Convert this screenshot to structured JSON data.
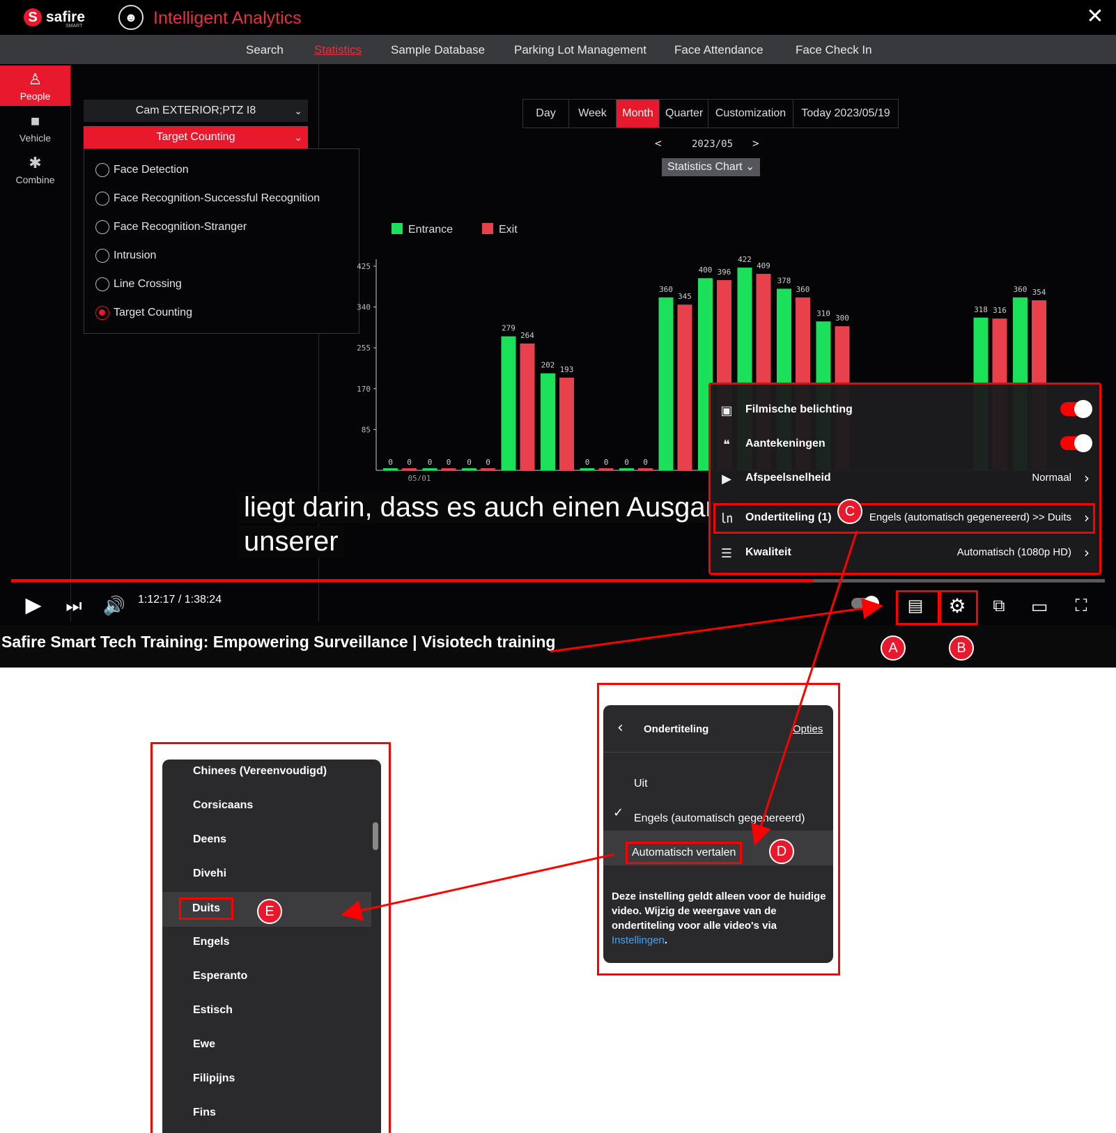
{
  "app": {
    "logo_text": "safire",
    "logo_sub": "SMART",
    "title": "Intelligent Analytics",
    "close": "✕"
  },
  "nav": [
    {
      "label": "Search",
      "active": false
    },
    {
      "label": "Statistics",
      "active": true
    },
    {
      "label": "Sample Database",
      "active": false
    },
    {
      "label": "Parking Lot Management",
      "active": false
    },
    {
      "label": "Face Attendance",
      "active": false
    },
    {
      "label": "Face Check In",
      "active": false
    }
  ],
  "sidebar": [
    {
      "label": "People",
      "icon": "people-icon",
      "active": true
    },
    {
      "label": "Vehicle",
      "icon": "vehicle-icon",
      "active": false
    },
    {
      "label": "Combine",
      "icon": "combine-icon",
      "active": false
    }
  ],
  "filters": {
    "camera": "Cam EXTERIOR;PTZ I8",
    "target": "Target Counting",
    "events": [
      {
        "label": "Face Detection",
        "selected": false
      },
      {
        "label": "Face Recognition-Successful Recognition",
        "selected": false
      },
      {
        "label": "Face Recognition-Stranger",
        "selected": false
      },
      {
        "label": "Intrusion",
        "selected": false
      },
      {
        "label": "Line Crossing",
        "selected": false
      },
      {
        "label": "Target Counting",
        "selected": true
      }
    ]
  },
  "period": {
    "tabs": [
      "Day",
      "Week",
      "Month",
      "Quarter",
      "Customization",
      "Today 2023/05/19"
    ],
    "active": "Month",
    "current": "2023/05",
    "prev": "<",
    "next": ">",
    "chart_type": "Statistics Chart"
  },
  "chart_data": {
    "type": "bar",
    "legend": [
      "Entrance",
      "Exit"
    ],
    "colors": {
      "Entrance": "#1be05a",
      "Exit": "#e8414b"
    },
    "y_ticks": [
      "85",
      "170",
      "255",
      "340",
      "425"
    ],
    "ylim": [
      0,
      425
    ],
    "x_first_label": "05/01",
    "series": [
      {
        "name": "Entrance",
        "values": [
          0,
          0,
          0,
          279,
          202,
          0,
          0,
          360,
          400,
          422,
          378,
          310,
          null,
          null,
          null,
          318,
          360
        ]
      },
      {
        "name": "Exit",
        "values": [
          0,
          0,
          0,
          264,
          193,
          0,
          0,
          345,
          396,
          409,
          360,
          300,
          null,
          null,
          null,
          316,
          354
        ]
      }
    ]
  },
  "subtitles": {
    "line1": "liegt darin, dass es auch einen Ausgar",
    "line2": "unserer"
  },
  "player": {
    "time": "1:12:17 / 1:38:24",
    "progress_fraction": 0.734,
    "title": "Safire Smart Tech Training: Empowering Surveillance | Visiotech training"
  },
  "settings_menu": {
    "rows": [
      {
        "label": "Filmische belichting",
        "type": "toggle",
        "on": true,
        "icon": "ambient-icon"
      },
      {
        "label": "Aantekeningen",
        "type": "toggle",
        "on": true,
        "icon": "annotations-icon"
      },
      {
        "label": "Afspeelsnelheid",
        "value": "Normaal",
        "icon": "playback-speed-icon"
      },
      {
        "label": "Ondertiteling (1)",
        "value": "Engels (automatisch gegenereerd) >> Duits",
        "icon": "cc-icon"
      },
      {
        "label": "Kwaliteit",
        "value": "Automatisch (1080p HD)",
        "icon": "quality-icon"
      }
    ]
  },
  "subs_panel": {
    "title": "Ondertiteling",
    "options_link": "Opties",
    "items": [
      "Uit",
      "Engels (automatisch gegenereerd)",
      "Automatisch vertalen"
    ],
    "checked": "Engels (automatisch gegenereerd)",
    "note": "Deze instelling geldt alleen voor de huidige video. Wijzig de weergave van de ondertiteling voor alle video's via",
    "note_link": "Instellingen",
    "note_end": "."
  },
  "languages": [
    "Chinees (Vereenvoudigd)",
    "Corsicaans",
    "Deens",
    "Divehi",
    "Duits",
    "Engels",
    "Esperanto",
    "Estisch",
    "Ewe",
    "Filipijns",
    "Fins"
  ],
  "selected_language": "Duits",
  "annotations": {
    "a": "A",
    "b": "B",
    "c": "C",
    "d": "D",
    "e": "E"
  }
}
